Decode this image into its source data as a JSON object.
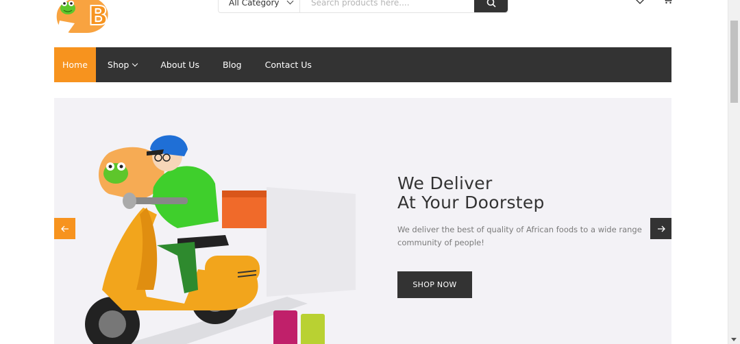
{
  "header": {
    "category_select": "All Category",
    "search_placeholder": "Search products here...."
  },
  "nav": {
    "items": [
      {
        "label": "Home",
        "active": true
      },
      {
        "label": "Shop",
        "has_dropdown": true
      },
      {
        "label": "About Us"
      },
      {
        "label": "Blog"
      },
      {
        "label": "Contact Us"
      }
    ]
  },
  "hero": {
    "title_line1": "We Deliver",
    "title_line2": "At Your Doorstep",
    "description": "We deliver the best of quality of African foods to a wide range community of people!",
    "cta_label": "SHOP NOW"
  },
  "colors": {
    "accent": "#f7931e",
    "dark": "#333333",
    "hero_bg": "#f3f2f6"
  },
  "icons": {
    "logo": "frog-b-logo",
    "search": "search-icon",
    "wishlist": "heart-icon",
    "cart": "cart-icon",
    "prev": "arrow-left-icon",
    "next": "arrow-right-icon"
  }
}
